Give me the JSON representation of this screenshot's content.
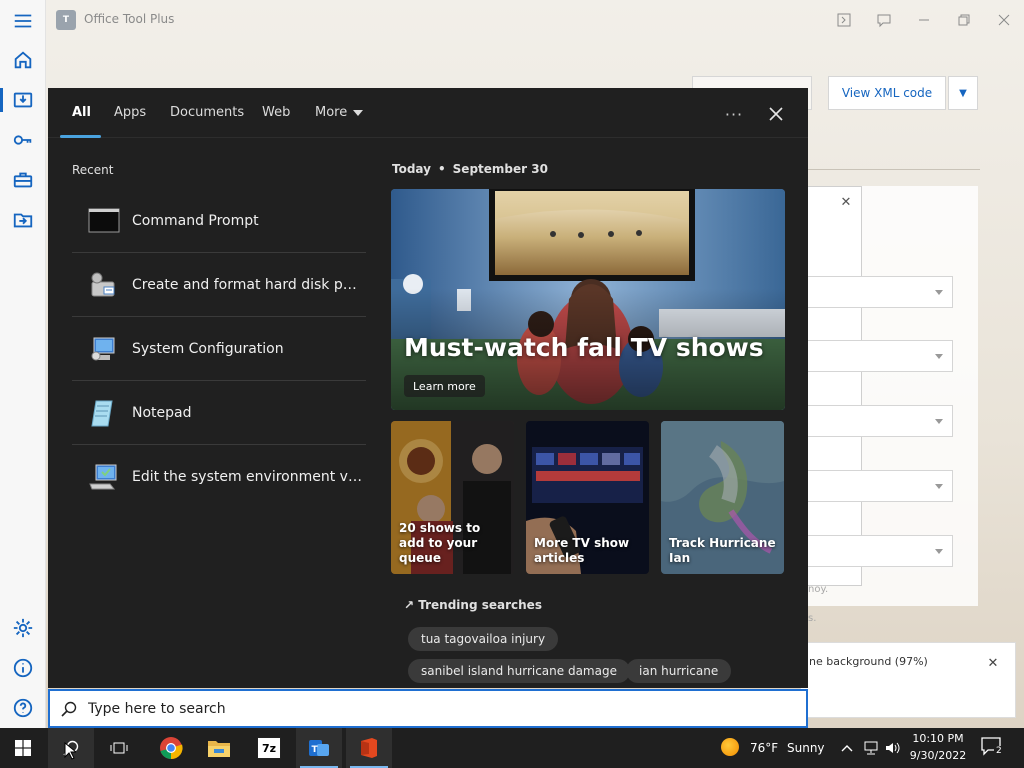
{
  "app": {
    "logo_text": "T",
    "title": "Office Tool Plus",
    "view_xml_label": "View XML code",
    "side_note_a": "noy.",
    "side_note_b": "s.",
    "toast_text": "ne background (97%)"
  },
  "search_panel": {
    "tabs": [
      {
        "label": "All",
        "active": true
      },
      {
        "label": "Apps"
      },
      {
        "label": "Documents"
      },
      {
        "label": "Web"
      },
      {
        "label": "More"
      }
    ],
    "ellipsis": "···",
    "recent_title": "Recent",
    "recent_items": [
      {
        "label": "Command Prompt",
        "icon": "command-prompt-icon"
      },
      {
        "label": "Create and format hard disk parti...",
        "icon": "disk-management-icon"
      },
      {
        "label": "System Configuration",
        "icon": "system-configuration-icon"
      },
      {
        "label": "Notepad",
        "icon": "notepad-icon"
      },
      {
        "label": "Edit the system environment vari...",
        "icon": "system-properties-icon"
      }
    ],
    "today_label": "Today",
    "today_sep": "•",
    "today_date": "September 30",
    "hero": {
      "title": "Must-watch fall TV shows",
      "cta": "Learn more"
    },
    "cards": [
      {
        "caption": "20 shows to add to your queue"
      },
      {
        "caption": "More TV show articles"
      },
      {
        "caption": "Track Hurricane Ian"
      }
    ],
    "trending_title": "Trending searches",
    "trending": [
      "tua tagovailoa injury",
      "sanibel island hurricane damage",
      "ian hurricane"
    ]
  },
  "search_box": {
    "placeholder": "Type here to search"
  },
  "taskbar": {
    "apps": [
      "start-icon",
      "search-icon",
      "task-view-icon",
      "chrome-icon",
      "file-explorer-icon",
      "7zip-icon",
      "office-tool-plus-icon",
      "office-icon"
    ],
    "sevenzip_label": "7z",
    "weather_temp": "76°F",
    "weather_cond": "Sunny",
    "time": "10:10 PM",
    "date": "9/30/2022",
    "notification_count": "2"
  },
  "colors": {
    "accent_blue": "#1565c0",
    "search_border": "#1f6fd1",
    "panel_bg": "#202020",
    "taskbar_bg": "#1f1f1f"
  }
}
